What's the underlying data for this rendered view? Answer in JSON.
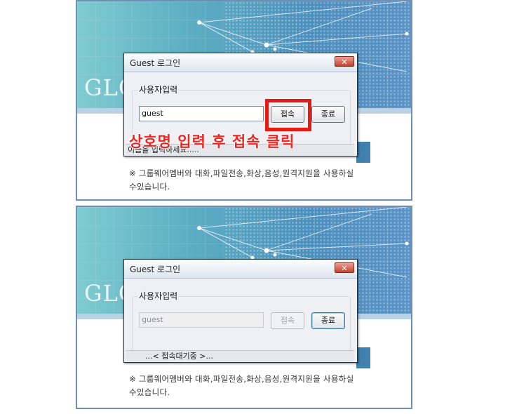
{
  "top": {
    "banner_title": "GLC",
    "notice": "※ 그룹웨어멤버와 대화,파일전송,화상,음성,원격지원을 사용하실수있습니다.",
    "dialog": {
      "title": "Guest 로그인",
      "close_label": "✕",
      "group_label": "사용자입력",
      "input_value": "guest",
      "connect_label": "접속",
      "exit_label": "종료",
      "status_text": "이름을 입력하세요....."
    },
    "annotation": "상호명 입력 후 접속 클릭",
    "annotation_color": "#f02323"
  },
  "bottom": {
    "banner_title": "GLC",
    "notice": "※ 그룹웨어멤버와 대화,파일전송,화상,음성,원격지원을 사용하실수있습니다.",
    "dialog": {
      "title": "Guest 로그인",
      "close_label": "✕",
      "group_label": "사용자입력",
      "input_value": "guest",
      "connect_label": "접속",
      "exit_label": "종료",
      "status_text": "...< 접속대기중 >..."
    }
  },
  "colors": {
    "panel_border": "#6f8fb7",
    "banner": "#5fb1c4",
    "close_button": "#c8412d"
  }
}
